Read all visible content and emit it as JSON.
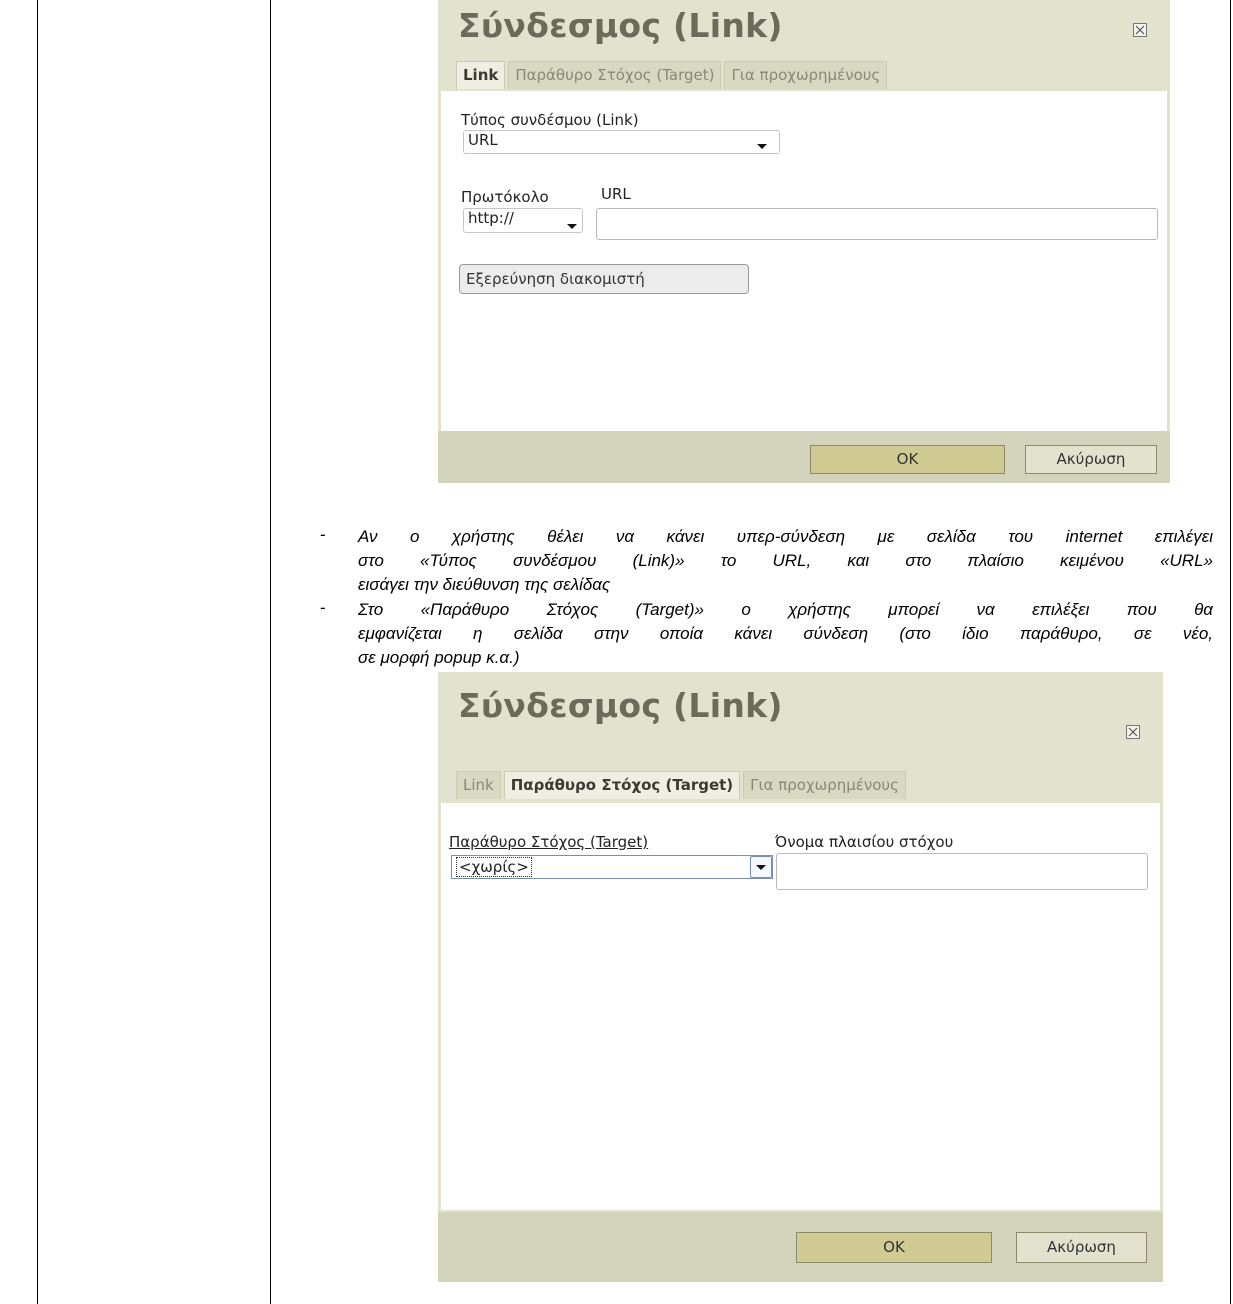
{
  "dialog1": {
    "title": "Σύνδεσμος (Link)",
    "tabs": [
      "Link",
      "Παράθυρο Στόχος (Target)",
      "Για προχωρημένους"
    ],
    "active_tab": 0,
    "link_type_label": "Τύπος συνδέσμου (Link)",
    "link_type_value": "URL",
    "protocol_label": "Πρωτόκολο",
    "protocol_value": "http://",
    "url_label": "URL",
    "url_value": "",
    "browse_button": "Εξερεύνηση διακομιστή",
    "ok_button": "OK",
    "cancel_button": "Ακύρωση"
  },
  "instructions": {
    "bullet_marker": "-",
    "item1_lines": [
      "Αν ο χρήστης θέλει να κάνει υπερ-σύνδεση με σελίδα του internet επιλέγει",
      "στο «Τύπος συνδέσμου (Link)» το URL, και στο πλαίσιο κειμένου «URL»",
      "εισάγει την διεύθυνση της σελίδας"
    ],
    "item2_lines": [
      "Στο «Παράθυρο Στόχος (Target)» ο χρήστης μπορεί να επιλέξει που θα",
      "εμφανίζεται η σελίδα στην οποία κάνει σύνδεση (στο ίδιο παράθυρο, σε νέο,",
      "σε μορφή popup κ.α.)"
    ]
  },
  "dialog2": {
    "title": "Σύνδεσμος (Link)",
    "tabs": [
      "Link",
      "Παράθυρο Στόχος (Target)",
      "Για προχωρημένους"
    ],
    "active_tab": 1,
    "target_label": "Παράθυρο Στόχος (Target)",
    "target_value": "<χωρίς>",
    "frame_name_label": "Όνομα πλαισίου στόχου",
    "frame_name_value": "",
    "ok_button": "OK",
    "cancel_button": "Ακύρωση"
  },
  "colors": {
    "dialog_bg": "#e3e2cf",
    "footer_bg": "#d4d3bc",
    "ok_button_bg": "#cfcb93",
    "title_color": "#6b6b5b"
  }
}
